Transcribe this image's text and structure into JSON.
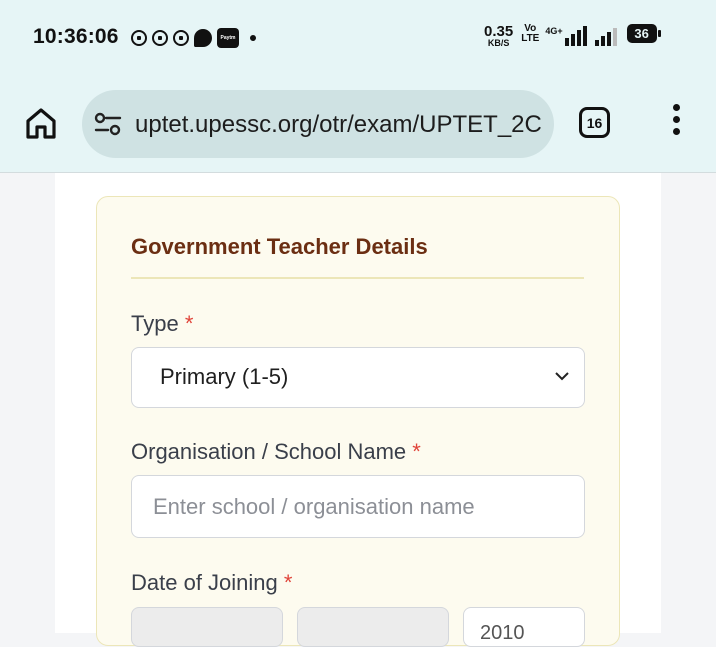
{
  "status_bar": {
    "time": "10:36:06",
    "net_speed": "0.35",
    "net_speed_unit": "KB/S",
    "volte_top": "Vo",
    "volte_bottom": "LTE",
    "network": "4G+",
    "battery": "36",
    "notification_icons": [
      "whatsapp-icon",
      "whatsapp-icon",
      "whatsapp-icon",
      "chat-icon",
      "paytm-icon"
    ]
  },
  "browser": {
    "url": "uptet.upessc.org/otr/exam/UPTET_2C",
    "tab_count": "16"
  },
  "form": {
    "section_title": "Government Teacher Details",
    "type": {
      "label": "Type",
      "required_mark": "*",
      "selected": "Primary (1-5)"
    },
    "school": {
      "label": "Organisation / School Name",
      "required_mark": "*",
      "placeholder": "Enter school / organisation name"
    },
    "date_of_joining": {
      "label": "Date of Joining",
      "required_mark": "*",
      "year_partial": "2010"
    }
  },
  "colors": {
    "status_bg": "#e6f5f6",
    "url_pill": "#cfe2e3",
    "section_bg": "#fdfbef",
    "section_border": "#ece6b8",
    "title": "#6b2e12",
    "required": "#e0443a"
  }
}
